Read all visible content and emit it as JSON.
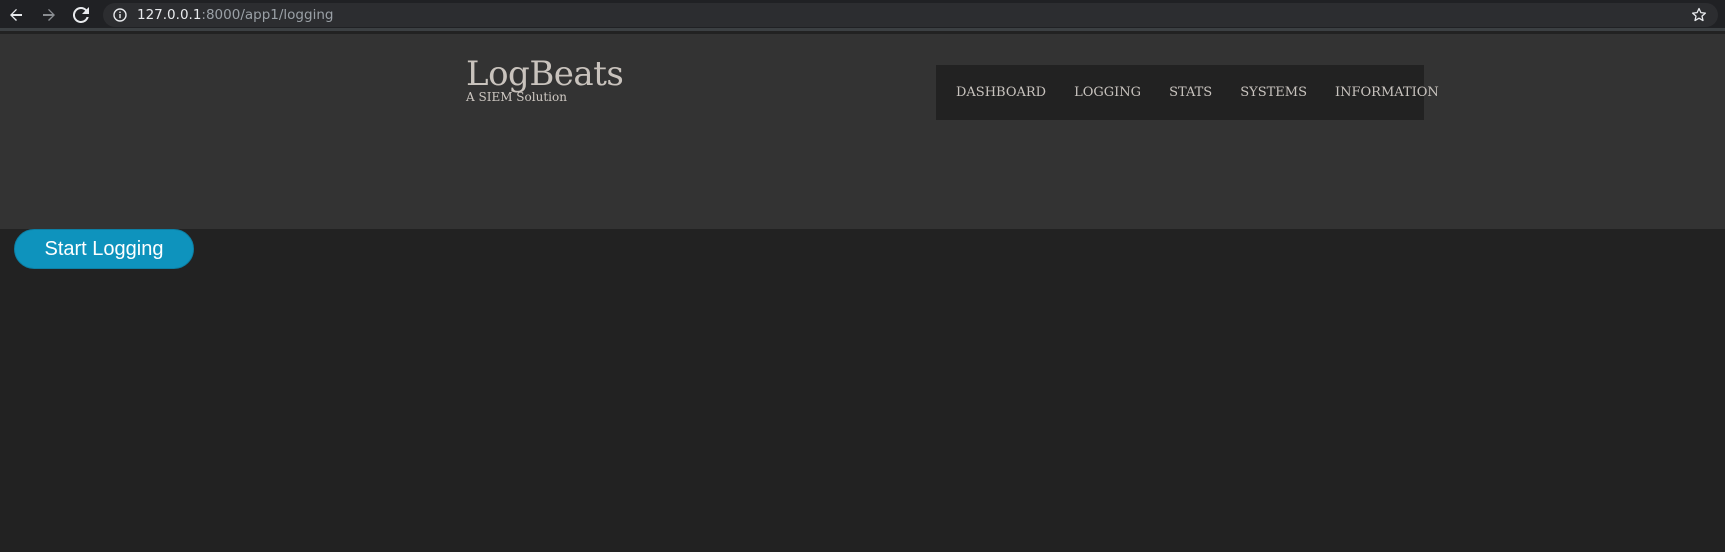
{
  "browser": {
    "url_host": "127.0.0.1",
    "url_rest": ":8000/app1/logging",
    "icons": {
      "back": "arrow-left-icon",
      "forward": "arrow-right-icon",
      "reload": "reload-icon",
      "info": "info-icon",
      "bookmark": "star-icon"
    }
  },
  "header": {
    "title": "LogBeats",
    "subtitle": "A SIEM Solution"
  },
  "nav": {
    "items": [
      {
        "label": "DASHBOARD"
      },
      {
        "label": "LOGGING"
      },
      {
        "label": "STATS"
      },
      {
        "label": "SYSTEMS"
      },
      {
        "label": "INFORMATION"
      }
    ]
  },
  "main": {
    "start_button_label": "Start Logging"
  },
  "colors": {
    "header_bg": "#333333",
    "page_bg": "#222222",
    "nav_bg": "#222222",
    "button_bg": "#0e93bd"
  }
}
